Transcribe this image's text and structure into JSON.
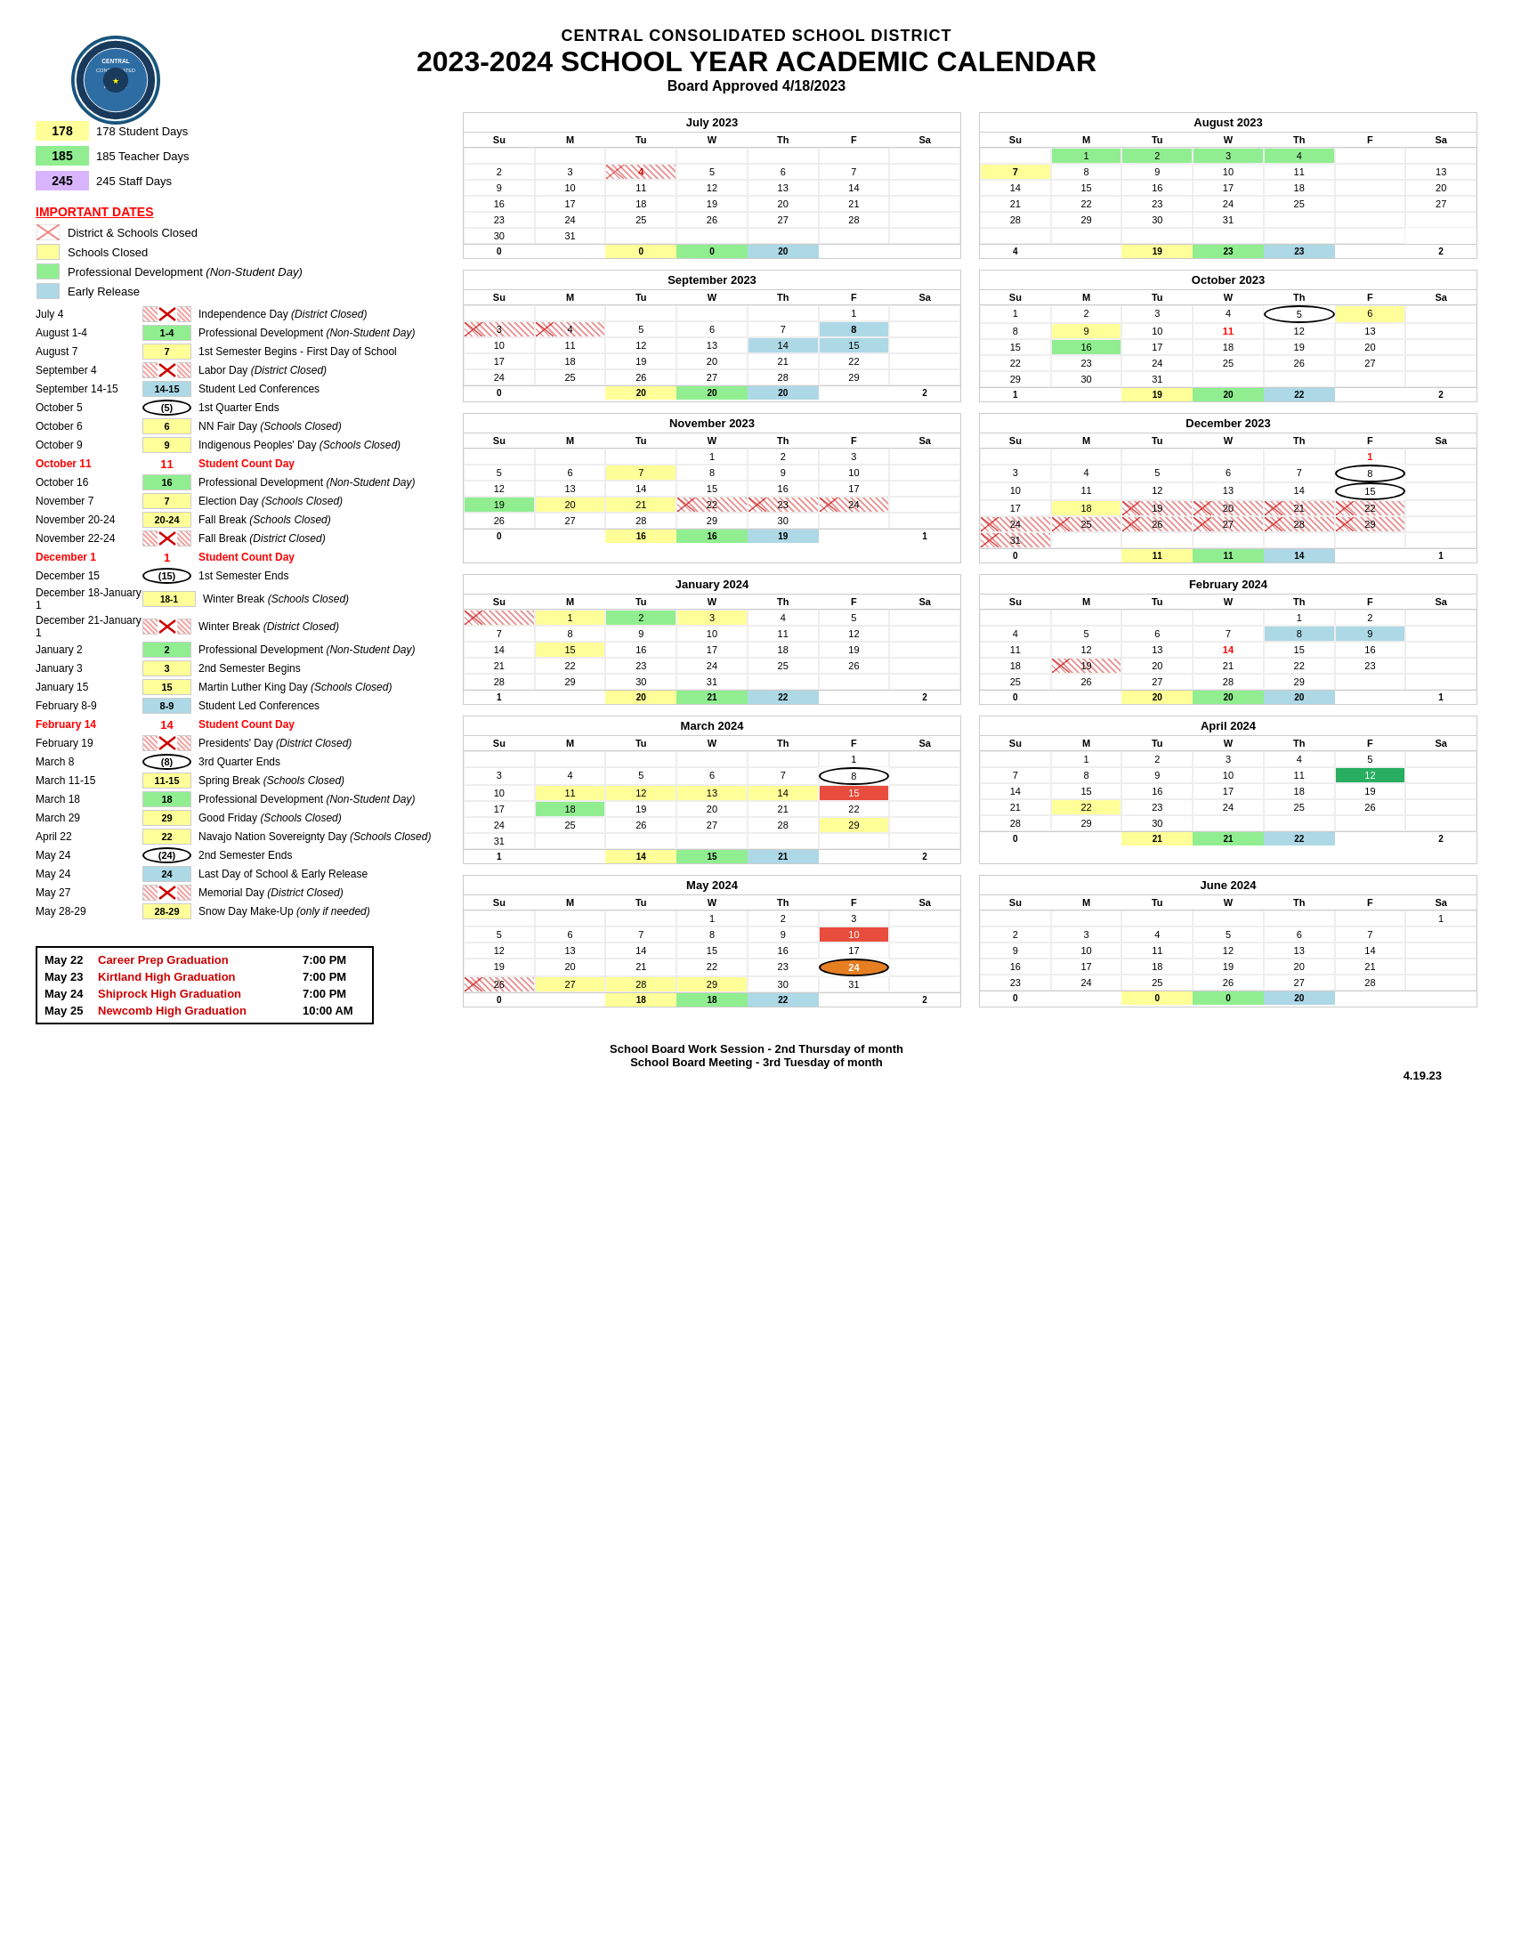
{
  "header": {
    "district": "CENTRAL CONSOLIDATED SCHOOL DISTRICT",
    "title": "2023-2024 SCHOOL YEAR ACADEMIC CALENDAR",
    "approved": "Board Approved 4/18/2023"
  },
  "stats": [
    {
      "num": "178",
      "label": "178 Student Days",
      "color": "#ffff99"
    },
    {
      "num": "185",
      "label": "185 Teacher Days",
      "color": "#90ee90"
    },
    {
      "num": "245",
      "label": "245 Staff Days",
      "color": "#d8b4fe"
    }
  ],
  "legend_title": "IMPORTANT DATES",
  "legend_items": [
    {
      "symbol": "X",
      "label": "District & Schools Closed"
    },
    {
      "symbol": "■",
      "label": "Schools Closed",
      "color": "#ffff99"
    },
    {
      "symbol": "■",
      "label": "Professional Development (Non-Student Day)",
      "color": "#90ee90"
    },
    {
      "symbol": "■",
      "label": "Early Release",
      "color": "#add8e6"
    }
  ],
  "dates": [
    {
      "date": "July 4",
      "badge": "X",
      "badge_type": "hatch",
      "desc": "Independence Day (District Closed)"
    },
    {
      "date": "August 1-4",
      "badge": "1-4",
      "badge_type": "green",
      "desc": "Professional Development (Non-Student Day)"
    },
    {
      "date": "August 7",
      "badge": "7",
      "badge_type": "yellow",
      "desc": "1st Semester Begins - First Day of School"
    },
    {
      "date": "September 4",
      "badge": "X",
      "badge_type": "hatch",
      "desc": "Labor Day (District Closed)"
    },
    {
      "date": "September 14-15",
      "badge": "14-15",
      "badge_type": "blue",
      "desc": "Student Led Conferences"
    },
    {
      "date": "October 5",
      "badge": "(5)",
      "badge_type": "circle",
      "desc": "1st Quarter Ends"
    },
    {
      "date": "October 6",
      "badge": "6",
      "badge_type": "yellow",
      "desc": "NN Fair Day (Schools Closed)"
    },
    {
      "date": "October 9",
      "badge": "9",
      "badge_type": "yellow",
      "desc": "Indigenous Peoples' Day (Schools Closed)"
    },
    {
      "date": "October 11",
      "badge": "11",
      "badge_type": "red-text",
      "desc": "Student Count Day",
      "red": true
    },
    {
      "date": "October 16",
      "badge": "16",
      "badge_type": "green",
      "desc": "Professional Development (Non-Student Day)"
    },
    {
      "date": "November 7",
      "badge": "7",
      "badge_type": "yellow",
      "desc": "Election Day (Schools Closed)"
    },
    {
      "date": "November 20-24",
      "badge": "20-24",
      "badge_type": "yellow",
      "desc": "Fall Break (Schools Closed)"
    },
    {
      "date": "November 22-24",
      "badge": "X",
      "badge_type": "hatch",
      "desc": "Fall Break (District Closed)"
    },
    {
      "date": "December 1",
      "badge": "1",
      "badge_type": "red-text",
      "desc": "Student Count Day",
      "red": true
    },
    {
      "date": "December 15",
      "badge": "(15)",
      "badge_type": "circle",
      "desc": "1st Semester Ends"
    },
    {
      "date": "December 18-January 1",
      "badge": "18-1",
      "badge_type": "yellow",
      "desc": "Winter Break (Schools Closed)"
    },
    {
      "date": "December 21-January 1",
      "badge": "X",
      "badge_type": "hatch",
      "desc": "Winter Break (District Closed)"
    },
    {
      "date": "January 2",
      "badge": "2",
      "badge_type": "green",
      "desc": "Professional Development (Non-Student Day)"
    },
    {
      "date": "January 3",
      "badge": "3",
      "badge_type": "yellow",
      "desc": "2nd Semester Begins"
    },
    {
      "date": "January 15",
      "badge": "15",
      "badge_type": "yellow",
      "desc": "Martin Luther King Day (Schools Closed)"
    },
    {
      "date": "February 8-9",
      "badge": "8-9",
      "badge_type": "blue",
      "desc": "Student Led Conferences"
    },
    {
      "date": "February 14",
      "badge": "14",
      "badge_type": "red-text",
      "desc": "Student Count Day",
      "red": true
    },
    {
      "date": "February 19",
      "badge": "X",
      "badge_type": "hatch",
      "desc": "Presidents' Day (District Closed)"
    },
    {
      "date": "March 8",
      "badge": "(8)",
      "badge_type": "circle",
      "desc": "3rd Quarter Ends"
    },
    {
      "date": "March 11-15",
      "badge": "11-15",
      "badge_type": "yellow",
      "desc": "Spring Break (Schools Closed)"
    },
    {
      "date": "March 18",
      "badge": "18",
      "badge_type": "green",
      "desc": "Professional Development (Non-Student Day)"
    },
    {
      "date": "March 29",
      "badge": "29",
      "badge_type": "yellow",
      "desc": "Good Friday (Schools Closed)"
    },
    {
      "date": "April 22",
      "badge": "22",
      "badge_type": "yellow",
      "desc": "Navajo Nation Sovereignty Day (Schools Closed)"
    },
    {
      "date": "May 24",
      "badge": "(24)",
      "badge_type": "circle",
      "desc": "2nd Semester Ends"
    },
    {
      "date": "May 24",
      "badge": "24",
      "badge_type": "blue",
      "desc": "Last Day of School & Early Release"
    },
    {
      "date": "May 27",
      "badge": "X",
      "badge_type": "hatch",
      "desc": "Memorial Day (District Closed)"
    },
    {
      "date": "May 28-29",
      "badge": "28-29",
      "badge_type": "yellow",
      "desc": "Snow Day Make-Up (only if needed)"
    }
  ],
  "graduations": [
    {
      "date": "May 22",
      "name": "Career Prep Graduation",
      "time": "7:00 PM"
    },
    {
      "date": "May 23",
      "name": "Kirtland High Graduation",
      "time": "7:00 PM"
    },
    {
      "date": "May 24",
      "name": "Shiprock High Graduation",
      "time": "7:00 PM"
    },
    {
      "date": "May 25",
      "name": "Newcomb High Graduation",
      "time": "10:00 AM"
    }
  ],
  "footer": {
    "line1": "School Board Work Session - 2nd Thursday of month",
    "line2": "School Board Meeting - 3rd Tuesday of month",
    "version": "4.19.23"
  },
  "calendars": {
    "july2023": {
      "title": "July 2023",
      "summary": [
        "0",
        "",
        "0",
        "0",
        "20",
        "",
        ""
      ]
    },
    "august2023": {
      "title": "August 2023",
      "summary": [
        "4",
        "",
        "19",
        "23",
        "23",
        "",
        "2"
      ]
    },
    "september2023": {
      "title": "September 2023",
      "summary": [
        "0",
        "",
        "20",
        "20",
        "20",
        "",
        "2"
      ]
    },
    "october2023": {
      "title": "October 2023",
      "summary": [
        "1",
        "",
        "19",
        "20",
        "22",
        "",
        "2"
      ]
    },
    "november2023": {
      "title": "November 2023",
      "summary": [
        "0",
        "",
        "16",
        "16",
        "19",
        "",
        "1"
      ]
    },
    "december2023": {
      "title": "December 2023",
      "summary": [
        "0",
        "",
        "11",
        "11",
        "14",
        "",
        "1"
      ]
    },
    "january2024": {
      "title": "January 2024",
      "summary": [
        "1",
        "",
        "20",
        "21",
        "22",
        "",
        "2"
      ]
    },
    "february2024": {
      "title": "February 2024",
      "summary": [
        "0",
        "",
        "20",
        "20",
        "20",
        "",
        "1"
      ]
    },
    "march2024": {
      "title": "March 2024",
      "summary": [
        "1",
        "",
        "14",
        "15",
        "21",
        "",
        "2"
      ]
    },
    "april2024": {
      "title": "April 2024",
      "summary": [
        "0",
        "",
        "21",
        "21",
        "22",
        "",
        "2"
      ]
    },
    "may2024": {
      "title": "May 2024",
      "summary": [
        "0",
        "",
        "18",
        "18",
        "22",
        "",
        "2"
      ]
    },
    "june2024": {
      "title": "June 2024",
      "summary": [
        "0",
        "",
        "0",
        "0",
        "20",
        "",
        ""
      ]
    }
  }
}
